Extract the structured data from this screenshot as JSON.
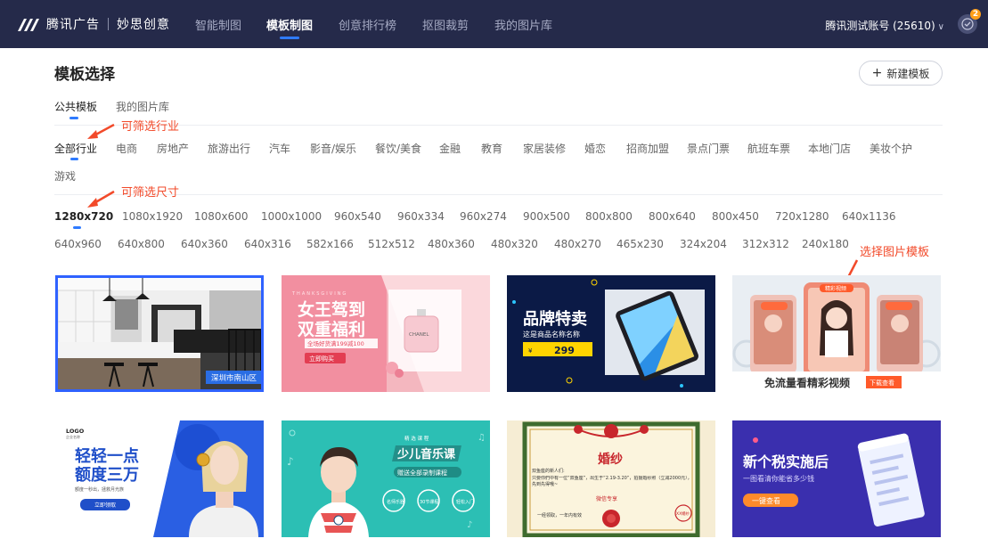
{
  "header": {
    "logo_text": "腾讯广告",
    "product": "妙思创意",
    "nav": [
      {
        "label": "智能制图",
        "active": false
      },
      {
        "label": "模板制图",
        "active": true
      },
      {
        "label": "创意排行榜",
        "active": false
      },
      {
        "label": "抠图裁剪",
        "active": false
      },
      {
        "label": "我的图片库",
        "active": false
      }
    ],
    "account": "腾讯测试账号 (25610)",
    "notification_count": "2"
  },
  "page": {
    "title": "模板选择",
    "new_button": "新建模板"
  },
  "tabs": [
    {
      "label": "公共模板",
      "active": true
    },
    {
      "label": "我的图片库",
      "active": false
    }
  ],
  "annotations": {
    "industry": "可筛选行业",
    "size": "可筛选尺寸",
    "template": "选择图片模板"
  },
  "industries": [
    "全部行业",
    "电商",
    "房地产",
    "旅游出行",
    "汽车",
    "影音/娱乐",
    "餐饮/美食",
    "金融",
    "教育",
    "家居装修",
    "婚恋",
    "招商加盟",
    "景点门票",
    "航班车票",
    "本地门店",
    "美妆个护",
    "游戏"
  ],
  "sizes": [
    "1280x720",
    "1080x1920",
    "1080x600",
    "1000x1000",
    "960x540",
    "960x334",
    "960x274",
    "900x500",
    "800x800",
    "800x640",
    "800x450",
    "720x1280",
    "640x1136",
    "640x960",
    "640x800",
    "640x360",
    "640x316",
    "582x166",
    "512x512",
    "480x360",
    "480x320",
    "480x270",
    "465x230",
    "324x204",
    "312x312",
    "240x180"
  ],
  "cards": {
    "c1": {
      "location": "深圳市南山区"
    },
    "c2": {
      "title1": "女王驾到",
      "title2": "双重福利",
      "sub": "全场好货满199减100",
      "btn": "立即购买",
      "deco": "THANKSGIVING",
      "brand": "CHANEL"
    },
    "c3": {
      "title": "品牌特卖",
      "sub": "这是商品名称名称",
      "price": "299",
      "yen": "¥"
    },
    "c4": {
      "title": "免流量看精彩视频",
      "btn": "下载查看",
      "tag": "精彩视频"
    },
    "c5": {
      "logo": "LOGO",
      "logo_sub": "企业名称",
      "line1": "轻轻一点",
      "line2": "额度三万",
      "sub": "额度一秒出，拯救月光族",
      "btn": "立即领取"
    },
    "c6": {
      "kicker": "精 选 课 程",
      "title": "少儿音乐课",
      "sub": "赠送全部录制课程",
      "b1": "名师乐器",
      "b2": "30节课程",
      "b3": "轻松入门"
    },
    "c7": {
      "title": "婚纱",
      "greet": "双鱼座的新人们:",
      "body": "只要你們中有一位“双鱼座”，出生于“2.19-3.20”，拍摄婚纱照（立减2000元），先到先得哦~",
      "stamp": "微信专享",
      "footer": "一经领取，一年内有效",
      "seal": "XX婚纱"
    },
    "c8": {
      "title": "新个税实施后",
      "sub": "一图看清你能省多少钱",
      "btn": "一键查看"
    }
  },
  "colors": {
    "nav_bg": "#252a4a",
    "accent": "#2f7bff",
    "annotation": "#f24a2a",
    "badge": "#ff9f1a"
  }
}
